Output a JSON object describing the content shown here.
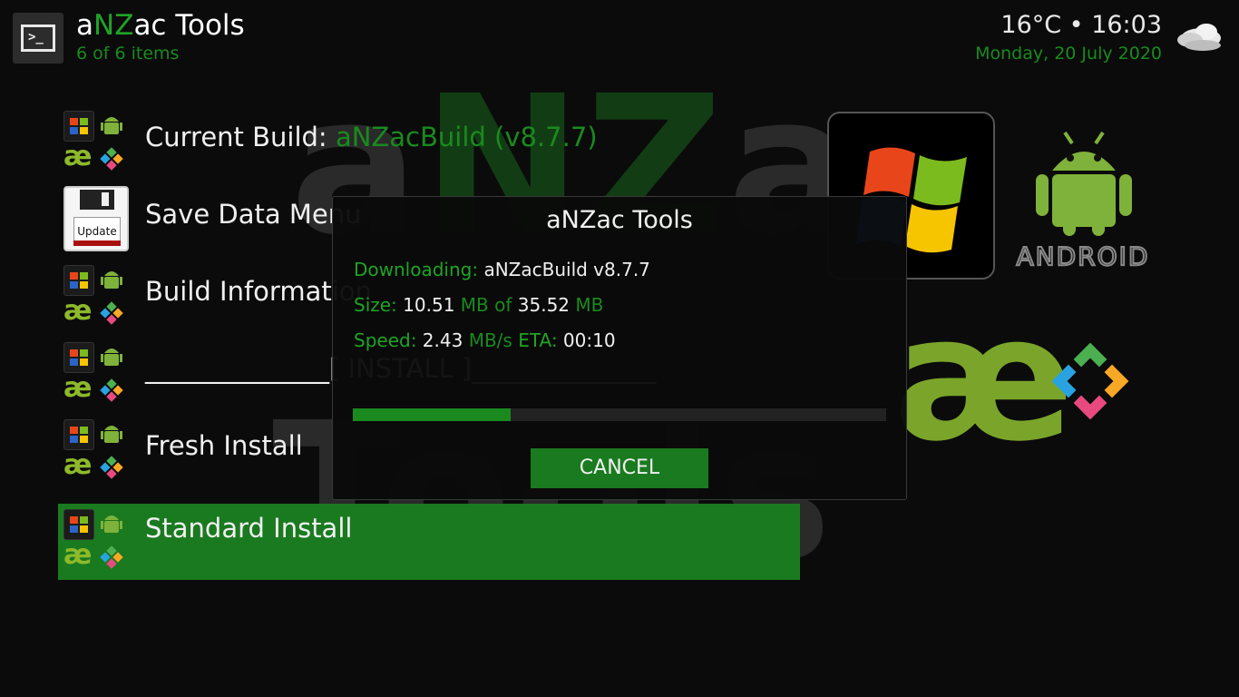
{
  "header": {
    "title_prefix": "a",
    "title_highlight": "NZ",
    "title_suffix": "ac Tools",
    "subtitle": "6 of 6 items",
    "weather": "16°C • 16:03",
    "date": "Monday, 20 July 2020",
    "terminal_glyph": ">_",
    "weather_icon": "cloud-icon"
  },
  "background": {
    "line1_a": "a",
    "line1_nz": "NZ",
    "line1_ac": "ac",
    "line2": "Tools"
  },
  "list": {
    "items": [
      {
        "label": "Current Build: ",
        "value": "aNZacBuild (v8.7.7)",
        "icon": "build-icon-grid"
      },
      {
        "label": "Save Data Menu",
        "icon": "floppy-disk-icon",
        "icon_text": "Update"
      },
      {
        "label": "Build Information",
        "icon": "build-icon-grid"
      },
      {
        "label": "______________[ INSTALL ]______________",
        "icon": "build-icon-grid"
      },
      {
        "label": "Fresh Install",
        "icon": "build-icon-grid"
      },
      {
        "label": "Standard Install",
        "icon": "build-icon-grid",
        "selected": true
      }
    ]
  },
  "dialog": {
    "title": "aNZac Tools",
    "downloading_label": "Downloading:",
    "downloading_value": "aNZacBuild v8.7.7",
    "size_label": "Size:",
    "size_done": "10.51",
    "size_unit1": "MB of",
    "size_total": "35.52",
    "size_unit2": "MB",
    "speed_label": "Speed:",
    "speed_value": "2.43",
    "speed_unit": "MB/s",
    "eta_label": "ETA:",
    "eta_value": "00:10",
    "progress": 0.296,
    "cancel_label": "CANCEL"
  },
  "art": {
    "android_text": "ANDROID"
  },
  "colors": {
    "accent": "#1a8a1f",
    "selected_bg": "#1a7a1f"
  }
}
